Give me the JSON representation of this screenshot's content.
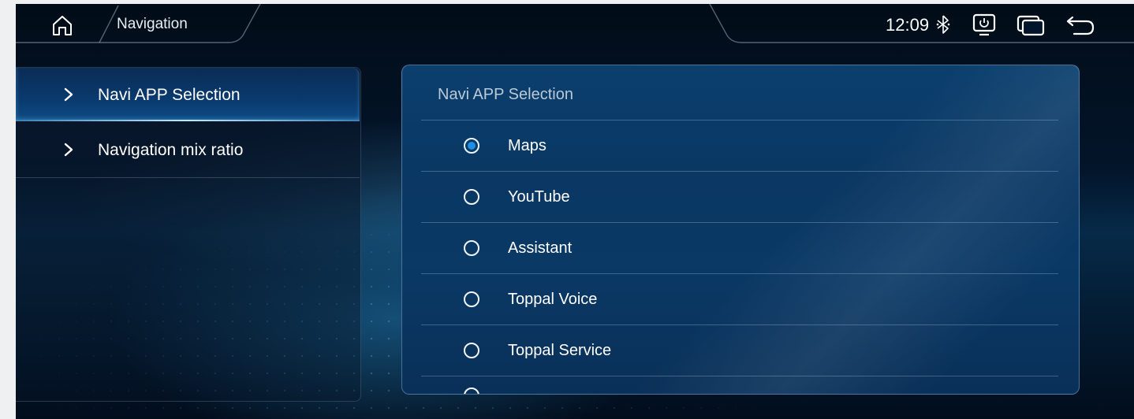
{
  "header": {
    "title": "Navigation",
    "time": "12:09",
    "icons": [
      "home-icon",
      "bluetooth-icon",
      "screen-power-icon",
      "multi-window-icon",
      "back-icon"
    ]
  },
  "menu": {
    "items": [
      {
        "label": "Navi APP Selection",
        "active": true
      },
      {
        "label": "Navigation mix ratio",
        "active": false
      }
    ]
  },
  "panel": {
    "title": "Navi APP Selection",
    "options": [
      {
        "label": "Maps",
        "selected": true
      },
      {
        "label": "YouTube",
        "selected": false
      },
      {
        "label": "Assistant",
        "selected": false
      },
      {
        "label": "Toppal Voice",
        "selected": false
      },
      {
        "label": "Toppal Service",
        "selected": false
      }
    ]
  },
  "colors": {
    "accent": "#1f8fe6",
    "background": "#03152a",
    "panel": "#0a3763"
  }
}
